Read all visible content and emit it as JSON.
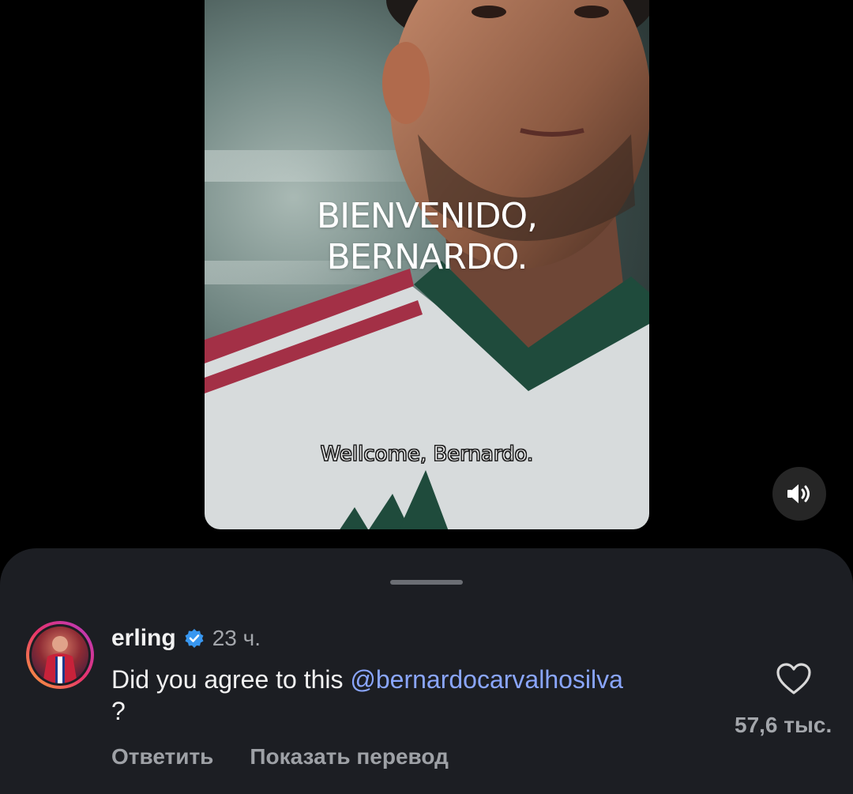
{
  "video": {
    "headline_line1": "BIENVENIDO,",
    "headline_line2": "BERNARDO.",
    "subtitle": "Wellcome, Bernardo.",
    "sound_icon": "speaker-on-icon"
  },
  "comment": {
    "username": "erling",
    "verified_icon": "verified-badge-icon",
    "time": "23 ч.",
    "text": "Did you agree to this ",
    "mention": "@bernardocarvalhosilva",
    "text_end": "?",
    "like_icon": "heart-outline-icon",
    "like_count": "57,6 тыс.",
    "reply_label": "Ответить",
    "translate_label": "Показать перевод"
  },
  "colors": {
    "sheet_background": "#1c1e23",
    "mention": "#8aa6ff",
    "verified": "#3897f0"
  }
}
